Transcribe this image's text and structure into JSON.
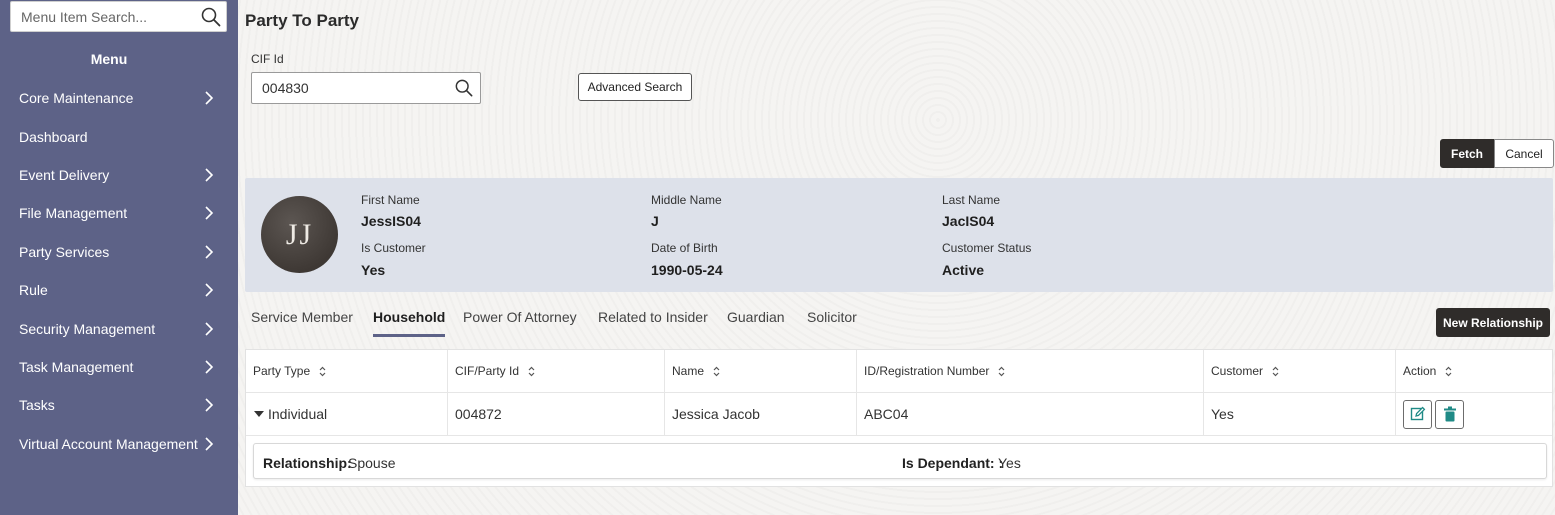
{
  "sidebar": {
    "search_placeholder": "Menu Item Search...",
    "menu_title": "Menu",
    "items": [
      {
        "label": "Core Maintenance",
        "has_children": true
      },
      {
        "label": "Dashboard",
        "has_children": false
      },
      {
        "label": "Event Delivery",
        "has_children": true
      },
      {
        "label": "File Management",
        "has_children": true
      },
      {
        "label": "Party Services",
        "has_children": true
      },
      {
        "label": "Rule",
        "has_children": true
      },
      {
        "label": "Security Management",
        "has_children": true
      },
      {
        "label": "Task Management",
        "has_children": true
      },
      {
        "label": "Tasks",
        "has_children": true
      },
      {
        "label": "Virtual Account Management",
        "has_children": true
      }
    ]
  },
  "page": {
    "title": "Party To Party",
    "cif_label": "CIF Id",
    "cif_value": "004830",
    "advanced_search_label": "Advanced Search",
    "fetch_label": "Fetch",
    "cancel_label": "Cancel"
  },
  "profile": {
    "initials": "JJ",
    "first_name_label": "First Name",
    "first_name": "JessIS04",
    "middle_name_label": "Middle Name",
    "middle_name": "J",
    "last_name_label": "Last Name",
    "last_name": "JacIS04",
    "is_customer_label": "Is Customer",
    "is_customer": "Yes",
    "dob_label": "Date of Birth",
    "dob": "1990-05-24",
    "status_label": "Customer Status",
    "status": "Active"
  },
  "tabs": [
    {
      "label": "Service Member",
      "active": false
    },
    {
      "label": "Household",
      "active": true
    },
    {
      "label": "Power Of Attorney",
      "active": false
    },
    {
      "label": "Related to Insider",
      "active": false
    },
    {
      "label": "Guardian",
      "active": false
    },
    {
      "label": "Solicitor",
      "active": false
    }
  ],
  "new_relationship_label": "New Relationship",
  "table": {
    "columns": [
      "Party Type",
      "CIF/Party Id",
      "Name",
      "ID/Registration Number",
      "Customer",
      "Action"
    ],
    "rows": [
      {
        "party_type": "Individual",
        "cif": "004872",
        "name": "Jessica Jacob",
        "id_reg": "ABC04",
        "customer": "Yes",
        "relationship_label": "Relationship:",
        "relationship": "Spouse",
        "dependant_label": "Is Dependant: :",
        "dependant": "Yes"
      }
    ]
  },
  "colors": {
    "sidebar_bg": "#5d6287",
    "dark_button": "#2f2c2a",
    "profile_bg": "#dde1ea",
    "action_icon": "#1f8a86"
  },
  "icons": {
    "search": "search-icon",
    "chevron": "chevron-right-icon",
    "sort": "sort-icon",
    "caret": "caret-down-icon",
    "edit": "edit-icon",
    "delete": "trash-icon"
  }
}
